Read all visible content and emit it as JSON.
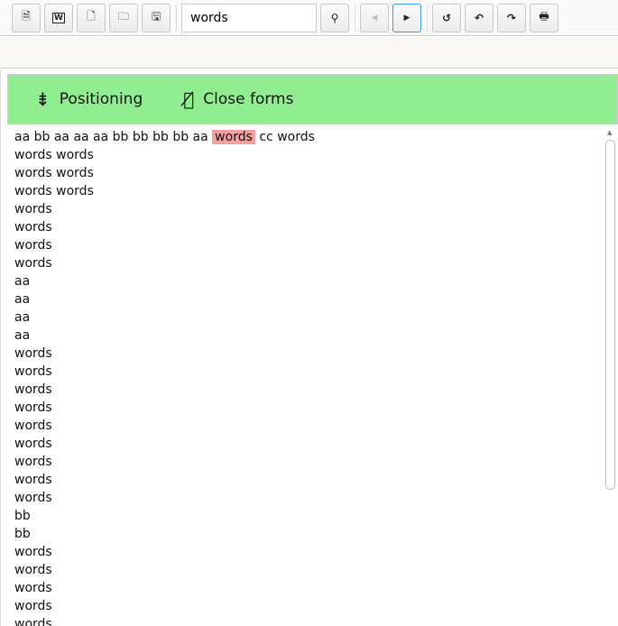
{
  "toolbar": {
    "search_value": "words",
    "icons": [
      "pdf-icon",
      "word-icon",
      "new-file-icon",
      "folder-icon",
      "save-icon",
      "search-icon",
      "prev-icon",
      "next-icon",
      "reset-icon",
      "undo-icon",
      "redo-icon",
      "print-icon"
    ]
  },
  "actions": {
    "positioning": "Positioning",
    "close_forms": "Close forms"
  },
  "document": {
    "first_line": {
      "before": "aa bb aa aa aa bb bb bb bb aa",
      "highlight": "words",
      "after": "cc words"
    },
    "lines": [
      "words words",
      "words words",
      "words words",
      "words",
      "words",
      "words",
      "words",
      "aa",
      "aa",
      "aa",
      "aa",
      "words",
      "words",
      "words",
      "words",
      "words",
      "words",
      "words",
      "words",
      "words",
      "bb",
      "bb",
      "words",
      "words",
      "words",
      "words",
      "words"
    ]
  },
  "colors": {
    "accent_bar": "#90ee90",
    "highlight": "#f4a0a0"
  }
}
